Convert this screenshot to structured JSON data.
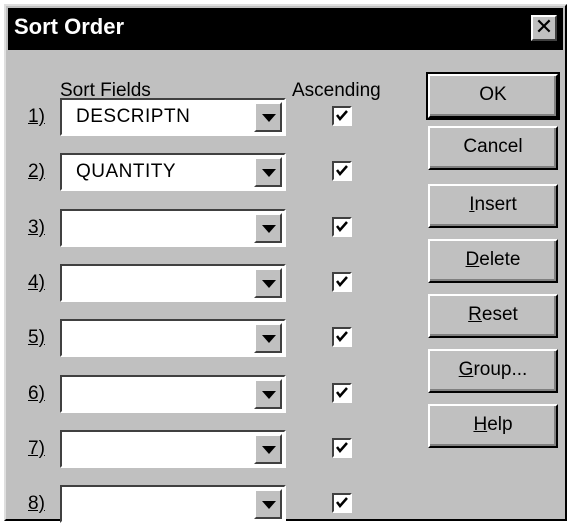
{
  "window": {
    "title": "Sort Order",
    "close_glyph": "✕"
  },
  "headers": {
    "fields": "Sort Fields",
    "ascending": "Ascending"
  },
  "rows": [
    {
      "num": "1)",
      "field": "DESCRIPTN",
      "ascending": true
    },
    {
      "num": "2)",
      "field": "QUANTITY",
      "ascending": true
    },
    {
      "num": "3)",
      "field": "",
      "ascending": true
    },
    {
      "num": "4)",
      "field": "",
      "ascending": true
    },
    {
      "num": "5)",
      "field": "",
      "ascending": true
    },
    {
      "num": "6)",
      "field": "",
      "ascending": true
    },
    {
      "num": "7)",
      "field": "",
      "ascending": true
    },
    {
      "num": "8)",
      "field": "",
      "ascending": true
    }
  ],
  "buttons": {
    "ok": "OK",
    "cancel": "Cancel",
    "insert": "Insert",
    "delete": "Delete",
    "reset": "Reset",
    "group": "Group...",
    "help": "Help"
  },
  "icons": {
    "combo": "dropdown-arrow-icon",
    "check": "checkmark-icon",
    "close": "close-icon"
  }
}
